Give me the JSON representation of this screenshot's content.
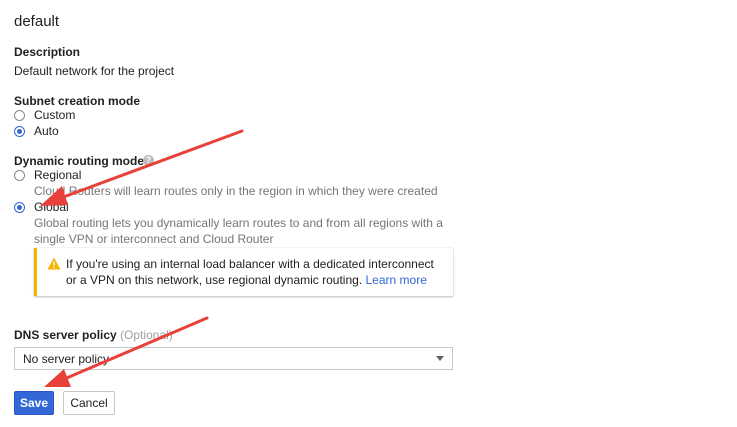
{
  "network": {
    "name": "default"
  },
  "description": {
    "label": "Description",
    "value": "Default network for the project"
  },
  "subnet_mode": {
    "label": "Subnet creation mode",
    "options": [
      {
        "label": "Custom",
        "checked": false
      },
      {
        "label": "Auto",
        "checked": true
      }
    ]
  },
  "routing_mode": {
    "label": "Dynamic routing mode",
    "help_icon": "?",
    "regional": {
      "label": "Regional",
      "checked": false,
      "hint": "Cloud Routers will learn routes only in the region in which they were created"
    },
    "global": {
      "label": "Global",
      "checked": true,
      "hint_line1": "Global routing lets you dynamically learn routes to and from all regions with a",
      "hint_line2": "single VPN or interconnect and Cloud Router"
    },
    "warning": {
      "icon": "warning-icon",
      "line1": "If you're using an internal load balancer with a dedicated interconnect",
      "line2": "or a VPN on this network, use regional dynamic routing.",
      "link": "Learn more"
    }
  },
  "dns_policy": {
    "label": "DNS server policy",
    "optional": "(Optional)",
    "value": "No server policy"
  },
  "actions": {
    "save": "Save",
    "cancel": "Cancel"
  },
  "colors": {
    "accent": "#3367d6",
    "warning": "#f4b400",
    "annotation_arrow": "#e8413a"
  }
}
